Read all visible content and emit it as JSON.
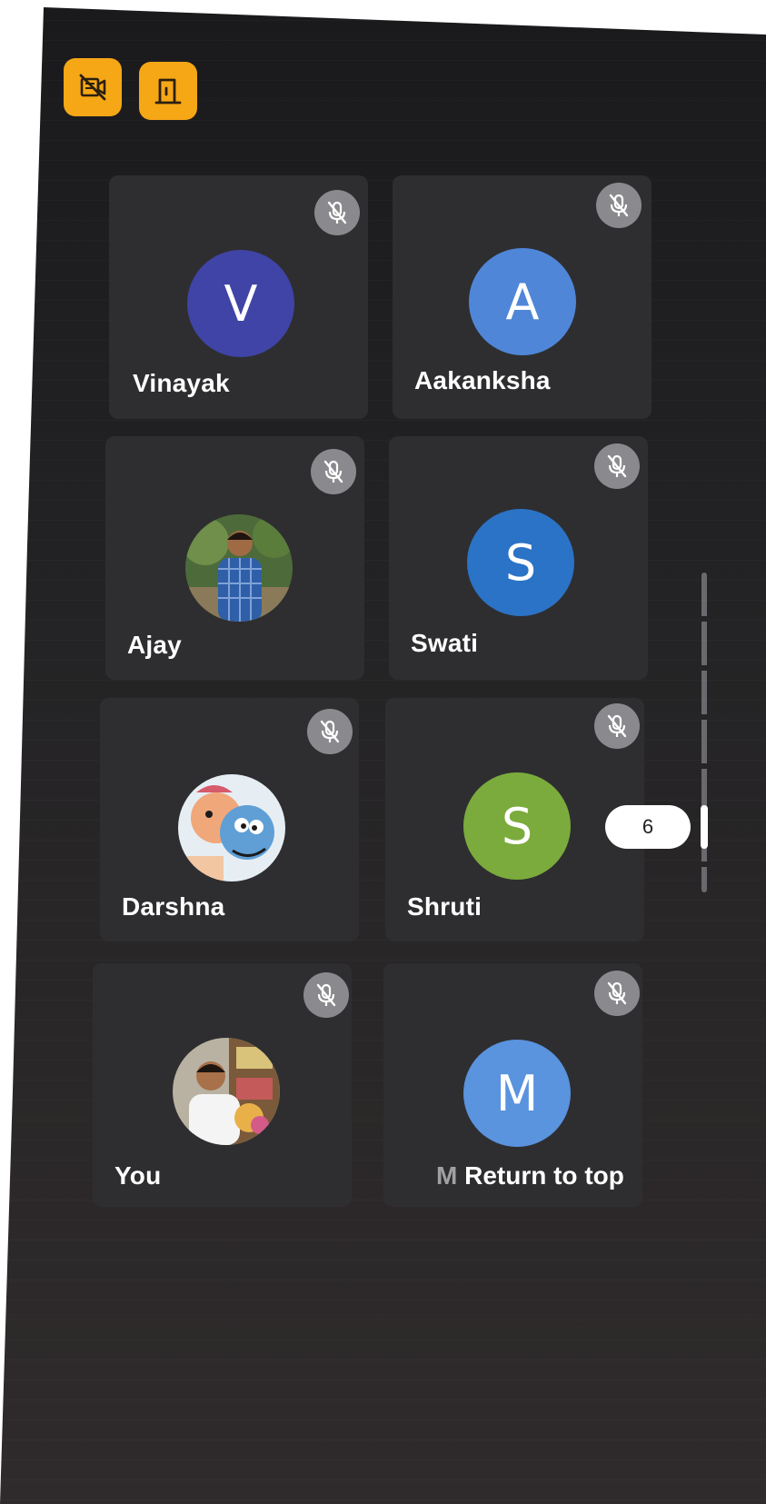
{
  "toolbar": {
    "buttons": [
      {
        "icon": "video-off-icon"
      },
      {
        "icon": "leave-door-icon"
      }
    ],
    "accent_color": "#f6a716"
  },
  "participants": [
    {
      "name": "Vinayak",
      "initial": "V",
      "avatar_color": "#3f44a6",
      "muted": true
    },
    {
      "name": "Aakanksha",
      "initial": "A",
      "avatar_color": "#4f86d8",
      "muted": true
    },
    {
      "name": "Ajay",
      "initial": "",
      "avatar_color": "#4d6b3a",
      "muted": true,
      "photo": true
    },
    {
      "name": "Swati",
      "initial": "S",
      "avatar_color": "#2b73c6",
      "muted": true
    },
    {
      "name": "Darshna",
      "initial": "",
      "avatar_color": "#d9e8f2",
      "muted": true,
      "photo": true
    },
    {
      "name": "Shruti",
      "initial": "S",
      "avatar_color": "#7bab3c",
      "muted": true
    },
    {
      "name": "You",
      "initial": "",
      "avatar_color": "#c9c3b4",
      "muted": true,
      "photo": true
    },
    {
      "name": "M",
      "initial": "M",
      "avatar_color": "#5a93de",
      "muted": true
    }
  ],
  "return_to_top": {
    "covered_name": "M",
    "label": "Return to top"
  },
  "scroll_indicator": {
    "page": "6"
  }
}
